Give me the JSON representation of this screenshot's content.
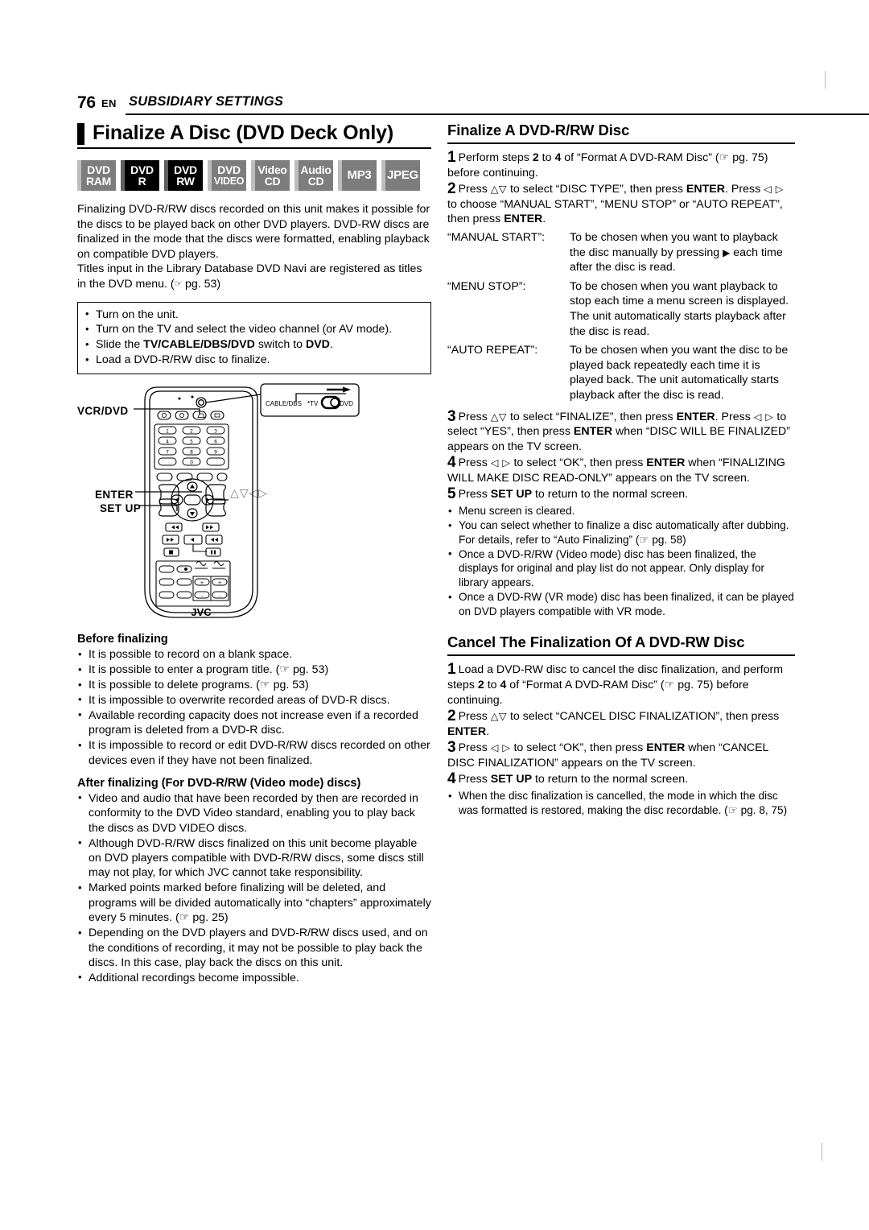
{
  "header": {
    "page_number": "76",
    "lang": "EN",
    "section": "SUBSIDIARY SETTINGS"
  },
  "left": {
    "heading": "Finalize A Disc (DVD Deck Only)",
    "badges": [
      {
        "name": "dvd-ram",
        "line1": "DVD",
        "line2": "RAM",
        "active": false
      },
      {
        "name": "dvd-r",
        "line1": "DVD",
        "line2": "R",
        "active": true
      },
      {
        "name": "dvd-rw",
        "line1": "DVD",
        "line2": "RW",
        "active": true
      },
      {
        "name": "dvd-video",
        "line1": "DVD",
        "line2": "VIDEO",
        "active": false
      },
      {
        "name": "video-cd",
        "line1": "Video",
        "line2": "CD",
        "active": false
      },
      {
        "name": "audio-cd",
        "line1": "Audio",
        "line2": "CD",
        "active": false
      },
      {
        "name": "mp3",
        "line1": "MP3",
        "line2": "",
        "active": false
      },
      {
        "name": "jpeg",
        "line1": "JPEG",
        "line2": "",
        "active": false
      }
    ],
    "intro_para_1": "Finalizing DVD-R/RW discs recorded on this unit makes it possible for the discs to be played back on other DVD players. DVD-RW discs are finalized in the mode that the discs were formatted, enabling playback on compatible DVD players.",
    "intro_para_2_a": "Titles input in the Library Database DVD Navi are registered as titles in the DVD menu. (",
    "intro_para_2_b": " pg. 53)",
    "prep_items": [
      "Turn on the unit.",
      "Turn on the TV and select the video channel (or AV mode).",
      "Load a DVD-R/RW disc to finalize."
    ],
    "prep_item_switch_pre": "Slide the ",
    "prep_item_switch_bold1": "TV/CABLE/DBS/DVD",
    "prep_item_switch_mid": " switch to ",
    "prep_item_switch_bold2": "DVD",
    "prep_item_switch_end": ".",
    "remote": {
      "label_vcr_dvd": "VCR/DVD",
      "label_enter": "ENTER",
      "label_set_up": "SET UP",
      "label_arrows": "△▽◁▷",
      "switch_cable_dbs": "CABLE/DBS",
      "switch_tv": "TV",
      "switch_dvd": "DVD",
      "brand": "JVC"
    },
    "before_heading": "Before finalizing",
    "before_items": [
      "It is possible to record on a blank space.",
      "It is possible to enter a program title. (☞ pg. 53)",
      "It is possible to delete programs. (☞ pg. 53)",
      "It is impossible to overwrite recorded areas of DVD-R discs.",
      "Available recording capacity does not increase even if a recorded program is deleted from a DVD-R disc.",
      "It is impossible to record or edit DVD-R/RW discs recorded on other devices even if they have not been finalized."
    ],
    "after_heading": "After finalizing (For DVD-R/RW (Video mode) discs)",
    "after_items": [
      "Video and audio that have been recorded by then are recorded in conformity to the DVD Video standard, enabling you to play back the discs as DVD VIDEO discs.",
      "Although DVD-R/RW discs finalized on this unit become playable on DVD players compatible with DVD-R/RW discs, some discs still may not play, for which JVC cannot take responsibility.",
      "Marked points marked before finalizing will be deleted, and programs will be divided automatically into “chapters” approximately every 5 minutes. (☞ pg. 25)",
      "Depending on the DVD players and DVD-R/RW discs used, and on the conditions of recording, it may not be possible to play back the discs. In this case, play back the discs on this unit.",
      "Additional recordings become impossible."
    ]
  },
  "right": {
    "heading_1": "Finalize A DVD-R/RW Disc",
    "step1_num": "1",
    "step1_a": "Perform steps ",
    "step1_b1": "2",
    "step1_c": " to ",
    "step1_b2": "4",
    "step1_d": " of “Format A DVD-RAM Disc” (☞ pg. 75) before continuing.",
    "step2_num": "2",
    "step2_a": "Press ",
    "step2_arrows1": "△▽",
    "step2_b": " to select “DISC TYPE”, then press ",
    "step2_bold1": "ENTER",
    "step2_c": ". Press ",
    "step2_arrows2": "◁ ▷",
    "step2_d": " to choose “MANUAL START”, “MENU STOP” or “AUTO REPEAT”, then press ",
    "step2_bold2": "ENTER",
    "step2_e": ".",
    "definitions": [
      {
        "term": "“MANUAL START”:",
        "desc_a": "To be chosen when you want to playback the disc manually by pressing ",
        "glyph": "▶",
        "desc_b": " each time after the disc is read."
      },
      {
        "term": "“MENU STOP”:",
        "desc_a": "To be chosen when you want playback to stop each time a menu screen is displayed. The unit automatically starts playback after the disc is read.",
        "glyph": "",
        "desc_b": ""
      },
      {
        "term": "“AUTO REPEAT”:",
        "desc_a": "To be chosen when you want the disc to be played back repeatedly each time it is played back. The unit automatically starts playback after the disc is read.",
        "glyph": "",
        "desc_b": ""
      }
    ],
    "step3_num": "3",
    "step3_a": "Press ",
    "step3_arrows1": "△▽",
    "step3_b": " to select “FINALIZE”, then press ",
    "step3_bold1": "ENTER",
    "step3_c": ". Press ",
    "step3_arrows2": "◁ ▷",
    "step3_d": " to select “YES”, then press ",
    "step3_bold2": "ENTER",
    "step3_e": " when “DISC WILL BE FINALIZED” appears on the TV screen.",
    "step4_num": "4",
    "step4_a": "Press ",
    "step4_arrows": "◁ ▷",
    "step4_b": " to select “OK”, then press ",
    "step4_bold": "ENTER",
    "step4_c": " when “FINALIZING WILL MAKE DISC READ-ONLY” appears on the TV screen.",
    "step5_num": "5",
    "step5_a": "Press ",
    "step5_bold": "SET UP",
    "step5_b": " to return to the normal screen.",
    "notes": [
      "Menu screen is cleared.",
      "You can select whether to finalize a disc automatically after dubbing. For details, refer to “Auto Finalizing” (☞ pg. 58)",
      "Once a DVD-R/RW (Video mode) disc has been finalized, the displays for original and play list do not appear. Only display for library appears.",
      "Once a DVD-RW (VR mode) disc has been finalized, it can be played on DVD players compatible with VR mode."
    ],
    "heading_2": "Cancel The Finalization Of A DVD-RW Disc",
    "c_step1_num": "1",
    "c_step1_a": "Load a DVD-RW disc to cancel the disc finalization, and perform steps ",
    "c_step1_b1": "2",
    "c_step1_c": " to ",
    "c_step1_b2": "4",
    "c_step1_d": " of “Format A DVD-RAM Disc” (☞ pg. 75) before continuing.",
    "c_step2_num": "2",
    "c_step2_a": "Press ",
    "c_step2_arrows": "△▽",
    "c_step2_b": " to select “CANCEL DISC FINALIZATION”, then press ",
    "c_step2_bold": "ENTER",
    "c_step2_c": ".",
    "c_step3_num": "3",
    "c_step3_a": "Press ",
    "c_step3_arrows": "◁ ▷",
    "c_step3_b": " to select “OK”, then press ",
    "c_step3_bold": "ENTER",
    "c_step3_c": " when “CANCEL DISC FINALIZATION” appears on the TV screen.",
    "c_step4_num": "4",
    "c_step4_a": "Press ",
    "c_step4_bold": "SET UP",
    "c_step4_b": " to return to the normal screen.",
    "c_notes": [
      "When the disc finalization is cancelled, the mode in which the disc was formatted is restored, making the disc recordable. (☞ pg. 8, 75)"
    ]
  }
}
